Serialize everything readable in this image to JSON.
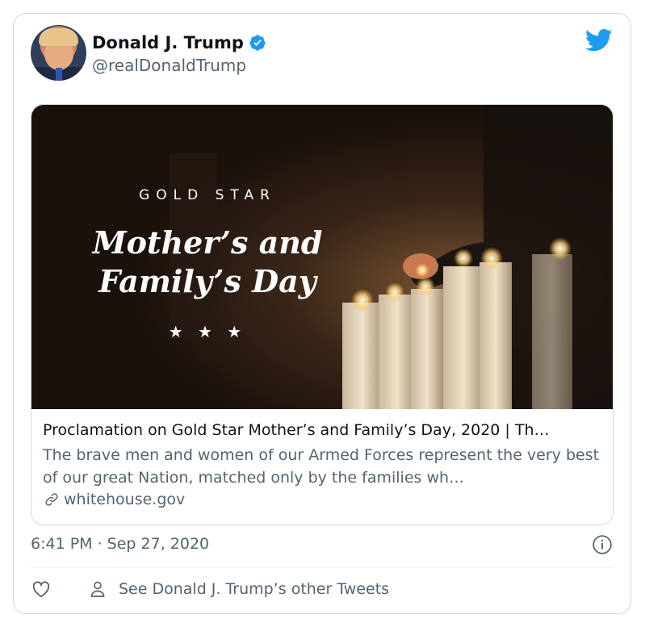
{
  "author": {
    "name": "Donald J. Trump",
    "handle": "@realDonaldTrump",
    "verified": true,
    "avatar_icon": "profile-photo"
  },
  "brand_icon": "twitter-bird-icon",
  "colors": {
    "accent": "#1d9bf0",
    "secondary_text": "#536471",
    "border": "#cfd9de"
  },
  "card": {
    "image": {
      "kicker": "GOLD STAR",
      "headline_line1": "Mother’s and",
      "headline_line2": "Family’s Day",
      "stars": "★ ★ ★"
    },
    "title": "Proclamation on Gold Star Mother’s and Family’s Day, 2020 | Th…",
    "description": "The brave men and women of our Armed Forces represent the very best of our great Nation, matched only by the families wh…",
    "domain": "whitehouse.gov"
  },
  "timestamp": "6:41 PM · Sep 27, 2020",
  "actions": {
    "other_tweets": "See Donald J. Trump’s other Tweets"
  }
}
